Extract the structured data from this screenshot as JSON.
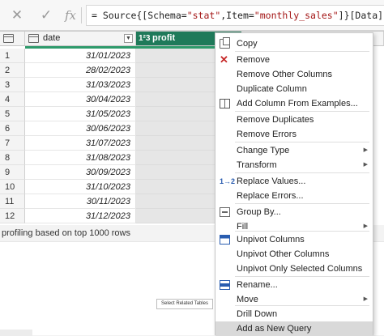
{
  "formula_bar": {
    "cancel_icon": "close-icon",
    "commit_icon": "check-icon",
    "fx_label": "fx",
    "formula_prefix": "= Source{[Schema=",
    "formula_schema": "\"stat\"",
    "formula_mid": ",Item=",
    "formula_item": "\"monthly_sales\"",
    "formula_suffix": "]}[Data]"
  },
  "grid": {
    "columns": [
      {
        "name": "date",
        "type_icon": "date-type-icon"
      },
      {
        "name": "profit",
        "type_icon": "number-type-icon",
        "type_label": "1²3",
        "selected": true
      }
    ],
    "rows": [
      {
        "n": "1",
        "date": "31/01/2023"
      },
      {
        "n": "2",
        "date": "28/02/2023"
      },
      {
        "n": "3",
        "date": "31/03/2023"
      },
      {
        "n": "4",
        "date": "30/04/2023"
      },
      {
        "n": "5",
        "date": "31/05/2023"
      },
      {
        "n": "6",
        "date": "30/06/2023"
      },
      {
        "n": "7",
        "date": "31/07/2023"
      },
      {
        "n": "8",
        "date": "31/08/2023"
      },
      {
        "n": "9",
        "date": "30/09/2023"
      },
      {
        "n": "10",
        "date": "31/10/2023"
      },
      {
        "n": "11",
        "date": "30/11/2023"
      },
      {
        "n": "12",
        "date": "31/12/2023"
      }
    ]
  },
  "status": {
    "profiling_text": "profiling based on top 1000 rows"
  },
  "lower": {
    "related_button": "Select Related Tables"
  },
  "context_menu": {
    "items": [
      {
        "label": "Copy",
        "icon": "copy-icon"
      },
      {
        "label": "Remove",
        "icon": "remove-icon"
      },
      {
        "label": "Remove Other Columns"
      },
      {
        "label": "Duplicate Column"
      },
      {
        "label": "Add Column From Examples...",
        "icon": "examples-icon"
      },
      {
        "label": "Remove Duplicates"
      },
      {
        "label": "Remove Errors"
      },
      {
        "label": "Change Type",
        "submenu": true
      },
      {
        "label": "Transform",
        "submenu": true
      },
      {
        "label": "Replace Values...",
        "icon": "replace-icon"
      },
      {
        "label": "Replace Errors..."
      },
      {
        "label": "Group By...",
        "icon": "group-icon"
      },
      {
        "label": "Fill",
        "submenu": true
      },
      {
        "label": "Unpivot Columns",
        "icon": "unpivot-icon"
      },
      {
        "label": "Unpivot Other Columns"
      },
      {
        "label": "Unpivot Only Selected Columns"
      },
      {
        "label": "Rename...",
        "icon": "rename-icon"
      },
      {
        "label": "Move",
        "submenu": true
      },
      {
        "label": "Drill Down"
      },
      {
        "label": "Add as New Query",
        "highlighted": true
      }
    ],
    "replace_icon_text": "1→2"
  },
  "colors": {
    "selected_header": "#1f7a5a",
    "quality_bar": "#2e9a6b"
  }
}
